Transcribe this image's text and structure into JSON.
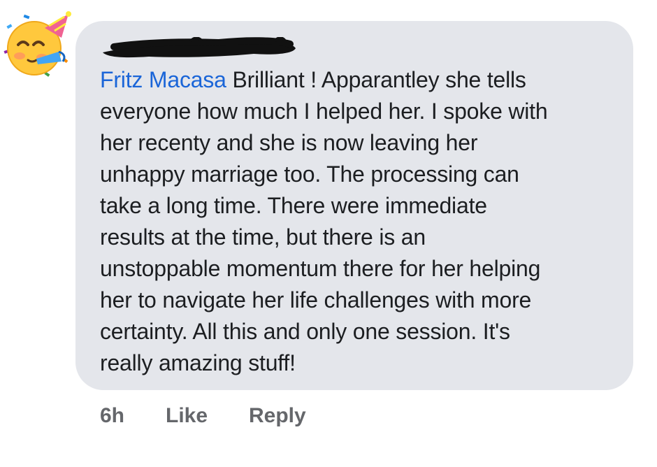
{
  "comment": {
    "author": "Fritz Macasa",
    "lines": [
      " Brilliant ! Apparantley she tells",
      "everyone how much I helped her. I spoke with",
      "her recenty and she is now leaving her",
      "unhappy marriage too. The processing can",
      "take a long time. There were immediate",
      "results at the time, but there is an",
      "unstoppable momentum there for her helping",
      "her to navigate her life challenges with more",
      "certainty. All this and only one session. It's",
      "really amazing stuff!"
    ]
  },
  "actions": {
    "time": "6h",
    "like": "Like",
    "reply": "Reply"
  },
  "avatar": {
    "icon": "partying-face-emoji-icon"
  },
  "colors": {
    "bubble": "#e4e6eb",
    "author_link": "#1a65d8",
    "text": "#1c1e21",
    "secondary": "#65676b"
  }
}
